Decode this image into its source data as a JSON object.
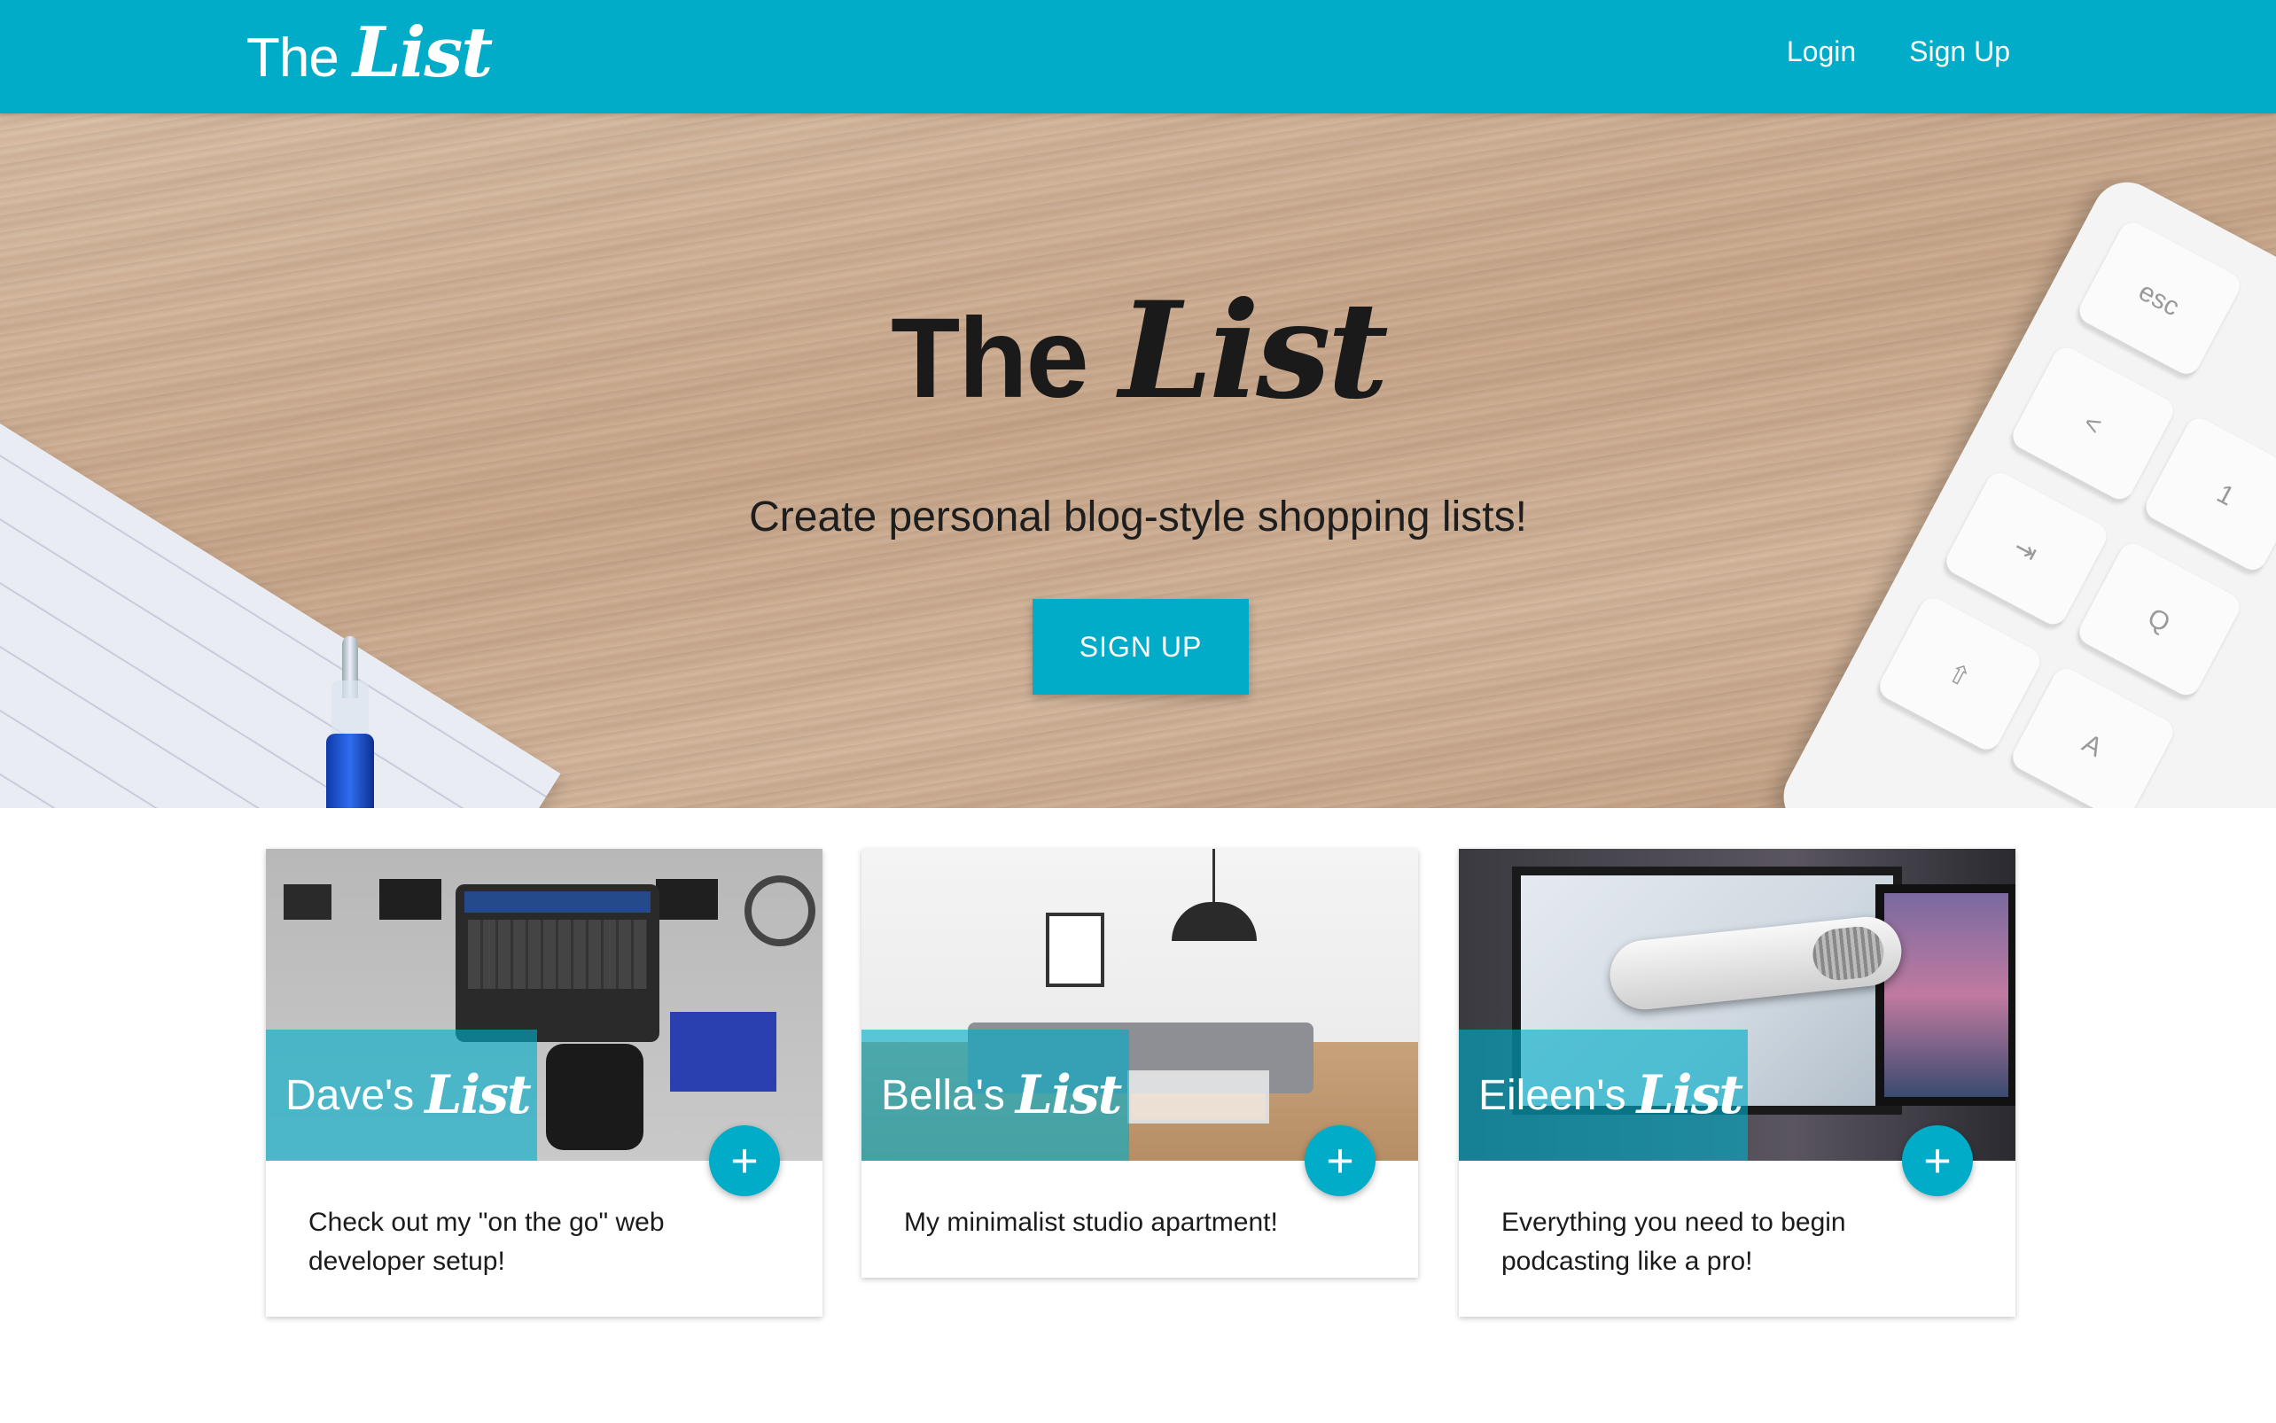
{
  "navbar": {
    "brand_the": "The",
    "brand_list": "List",
    "links": [
      "Login",
      "Sign Up"
    ],
    "color": "#00acc8"
  },
  "hero": {
    "title_the": "The",
    "title_list": "List",
    "subtitle": "Create personal blog-style shopping lists!",
    "button_label": "SIGN UP",
    "keys": [
      "esc",
      "<",
      "1",
      "⇥",
      "Q",
      "⇧",
      "A"
    ]
  },
  "cards": [
    {
      "owner": "Dave's",
      "list_word": "List",
      "description": "Check out my \"on the go\" web developer setup!",
      "add_icon": "+",
      "scene": "desk-setup"
    },
    {
      "owner": "Bella's",
      "list_word": "List",
      "description": "My minimalist studio apartment!",
      "add_icon": "+",
      "scene": "living-room"
    },
    {
      "owner": "Eileen's",
      "list_word": "List",
      "description": "Everything you need to begin podcasting like a pro!",
      "add_icon": "+",
      "scene": "podcast-studio"
    }
  ]
}
